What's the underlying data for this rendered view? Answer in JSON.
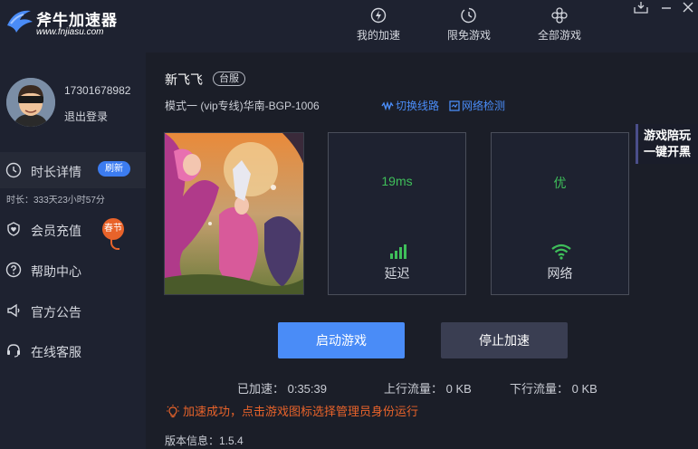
{
  "app": {
    "logo_name": "斧牛加速器",
    "logo_url": "www.fnjiasu.com"
  },
  "nav": {
    "my_boost": "我的加速",
    "free_games": "限免游戏",
    "all_games": "全部游戏"
  },
  "user": {
    "phone": "17301678982",
    "logout": "退出登录"
  },
  "sidebar": {
    "items": [
      {
        "label": "时长详情"
      },
      {
        "label": "会员充值"
      },
      {
        "label": "帮助中心"
      },
      {
        "label": "官方公告"
      },
      {
        "label": "在线客服"
      }
    ],
    "refresh_badge": "刷新",
    "duration": "时长：333天23小时57分",
    "spring_badge": "春节"
  },
  "game": {
    "title": "新飞飞",
    "server_tag": "台服",
    "mode_line": "模式一  (vip专线)华南-BGP-1006",
    "switch_route": "切换线路",
    "network_check": "网络检测"
  },
  "stats_panels": {
    "latency_value": "19ms",
    "latency_label": "延迟",
    "network_value": "优",
    "network_label": "网络"
  },
  "promo": {
    "line1": "游戏陪玩",
    "line2": "一键开黑"
  },
  "buttons": {
    "start_game": "启动游戏",
    "stop_boost": "停止加速"
  },
  "status": {
    "boosted": "已加速：  0:35:39",
    "upload": "上行流量：  0 KB",
    "download": "下行流量：  0 KB",
    "notice": "加速成功，点击游戏图标选择管理员身份运行",
    "version": "版本信息：1.5.4"
  },
  "colors": {
    "accent": "#4a8cf7",
    "good": "#3fbf5a",
    "warning": "#e8632a",
    "background": "#1b1e28",
    "sidebar": "#1e2230"
  }
}
